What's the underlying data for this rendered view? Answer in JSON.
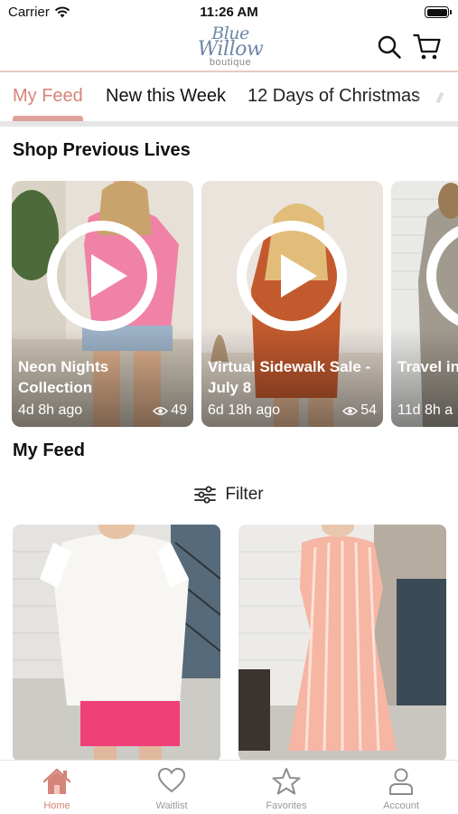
{
  "status_bar": {
    "carrier": "Carrier",
    "time": "11:26 AM"
  },
  "header": {
    "logo": {
      "line1": "Blue",
      "line2": "Willow",
      "line3": "boutique"
    },
    "icons": [
      "search-icon",
      "cart-icon"
    ]
  },
  "tabs": [
    {
      "label": "My Feed",
      "active": true
    },
    {
      "label": "New this Week",
      "active": false
    },
    {
      "label": "12 Days of Christmas",
      "active": false
    }
  ],
  "lives": {
    "title": "Shop Previous Lives",
    "items": [
      {
        "title": "Neon Nights Collection",
        "ago": "4d 8h ago",
        "views": "49"
      },
      {
        "title": "Virtual Sidewalk Sale - July 8",
        "ago": "6d 18h ago",
        "views": "54"
      },
      {
        "title": "Travel in",
        "ago": "11d 8h a",
        "views": ""
      }
    ]
  },
  "feed": {
    "title": "My Feed",
    "filter_label": "Filter"
  },
  "bottom_nav": [
    {
      "label": "Home",
      "icon": "home-icon",
      "active": true
    },
    {
      "label": "Waitlist",
      "icon": "heart-icon",
      "active": false
    },
    {
      "label": "Favorites",
      "icon": "star-icon",
      "active": false
    },
    {
      "label": "Account",
      "icon": "account-icon",
      "active": false
    }
  ],
  "colors": {
    "accent": "#d58479",
    "logo_blue": "#6f87a6",
    "divider": "#e8cac5"
  }
}
